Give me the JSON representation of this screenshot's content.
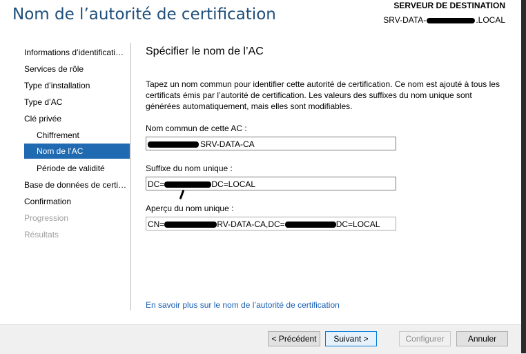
{
  "header": {
    "title": "Nom de l’autorité de certification",
    "dest_label": "SERVEUR DE DESTINATION",
    "dest_server_prefix": "SRV-DATA-",
    "dest_server_suffix": ".LOCAL"
  },
  "sidebar": {
    "items": [
      {
        "label": "Informations d’identificati…",
        "state": "normal"
      },
      {
        "label": "Services de rôle",
        "state": "normal"
      },
      {
        "label": "Type d’installation",
        "state": "normal"
      },
      {
        "label": "Type d’AC",
        "state": "normal"
      },
      {
        "label": "Clé privée",
        "state": "normal"
      },
      {
        "label": "Chiffrement",
        "state": "sub"
      },
      {
        "label": "Nom de l’AC",
        "state": "active"
      },
      {
        "label": "Période de validité",
        "state": "sub"
      },
      {
        "label": "Base de données de certi…",
        "state": "normal"
      },
      {
        "label": "Confirmation",
        "state": "normal"
      },
      {
        "label": "Progression",
        "state": "disabled"
      },
      {
        "label": "Résultats",
        "state": "disabled"
      }
    ]
  },
  "main": {
    "section_title": "Spécifier le nom de l’AC",
    "description": "Tapez un nom commun pour identifier cette autorité de certification. Ce nom est ajouté à tous les certificats émis par l’autorité de certification. Les valeurs des suffixes du nom unique sont générées automatiquement, mais elles sont modifiables.",
    "common_name_label": "Nom commun de cette AC :",
    "common_name_value": "SRV-DATA-CA",
    "suffix_label": "Suffixe du nom unique :",
    "suffix_value_prefix": "DC=",
    "suffix_value_suffix": "DC=LOCAL",
    "preview_label": "Aperçu du nom unique :",
    "preview_value_prefix": "CN=",
    "preview_value_mid": "RV-DATA-CA,DC=",
    "preview_value_suffix": "DC=LOCAL",
    "learn_more_link": "En savoir plus sur le nom de l’autorité de certification"
  },
  "footer": {
    "prev_button": "< Précédent",
    "next_button": "Suivant >",
    "configure_button": "Configurer",
    "cancel_button": "Annuler"
  },
  "colors": {
    "title": "#1e4e79",
    "active_nav": "#1f6ab0",
    "link": "#1a5fb4"
  }
}
